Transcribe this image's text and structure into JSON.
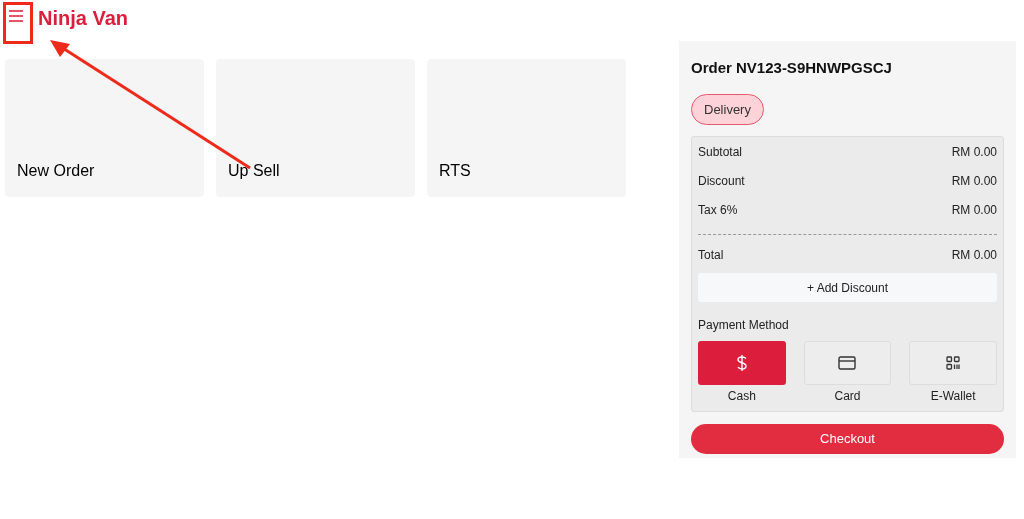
{
  "header": {
    "brand": "Ninja Van"
  },
  "tiles": [
    {
      "label": "New Order"
    },
    {
      "label": "Up Sell"
    },
    {
      "label": "RTS"
    }
  ],
  "order": {
    "title": "Order NV123-S9HNWPGSCJ",
    "type": "Delivery",
    "summary": [
      {
        "label": "Subtotal",
        "value": "RM 0.00",
        "kind": "line"
      },
      {
        "label": "Discount",
        "value": "RM 0.00",
        "kind": "line"
      },
      {
        "label": "Tax 6%",
        "value": "RM 0.00",
        "kind": "line"
      },
      {
        "label": "Total",
        "value": "RM 0.00",
        "kind": "total"
      }
    ],
    "add_discount": "+ Add Discount",
    "payment_label": "Payment Method",
    "payment_methods": [
      {
        "label": "Cash",
        "kind": "cash",
        "selected": true
      },
      {
        "label": "Card",
        "kind": "card",
        "selected": false
      },
      {
        "label": "E-Wallet",
        "kind": "wallet",
        "selected": false
      }
    ],
    "checkout": "Checkout"
  }
}
